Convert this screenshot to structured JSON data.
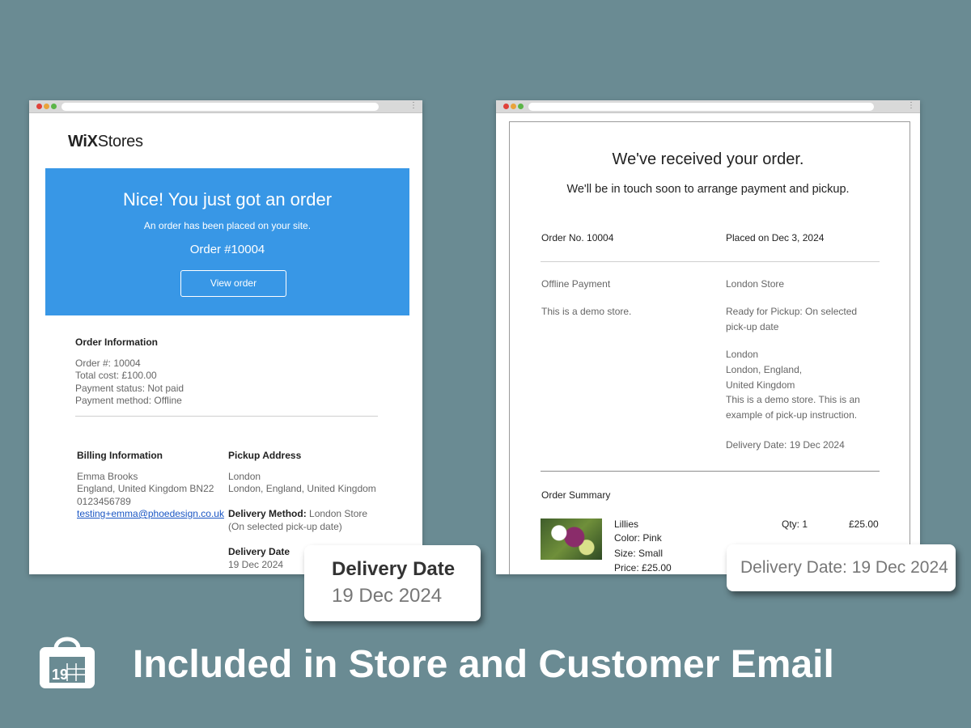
{
  "store_email": {
    "logo": {
      "bold": "WiX",
      "light": "Stores"
    },
    "banner": {
      "title": "Nice! You just got an order",
      "subtitle": "An order has been placed on your site.",
      "order_number": "Order #10004",
      "button": "View order"
    },
    "order_info": {
      "heading": "Order Information",
      "lines": [
        "Order #: 10004",
        "Total cost: £100.00",
        "Payment status: Not paid",
        "Payment method: Offline"
      ]
    },
    "billing": {
      "heading": "Billing Information",
      "name": "Emma Brooks",
      "address": "England, United Kingdom BN22",
      "phone": "0123456789",
      "email": "testing+emma@phoedesign.co.uk"
    },
    "pickup": {
      "heading": "Pickup Address",
      "city": "London",
      "address": "London, England, United Kingdom",
      "method_label": "Delivery Method:",
      "method_value": "London Store",
      "method_note": "(On selected pick-up date)",
      "date_heading": "Delivery Date",
      "date_value": "19 Dec 2024"
    }
  },
  "customer_email": {
    "title": "We've received your order.",
    "subtitle": "We'll be in touch soon to arrange payment and pickup.",
    "order_no": "Order No. 10004",
    "placed_on": "Placed on Dec 3, 2024",
    "payment_title": "Offline Payment",
    "payment_note": "This is a demo store.",
    "store_name": "London Store",
    "pickup_status_1": "Ready for Pickup: On selected",
    "pickup_status_2": "pick-up date",
    "addr_1": "London",
    "addr_2": "London, England,",
    "addr_3": "United Kingdom",
    "instr_1": "This is a demo store. This is an",
    "instr_2": "example of pick-up instruction.",
    "delivery_date": "Delivery Date: 19 Dec 2024",
    "summary_heading": "Order Summary",
    "item": {
      "name": "Lillies",
      "color": "Color: Pink",
      "size": "Size: Small",
      "price": "Price: £25.00",
      "qty": "Qty: 1",
      "total": "£25.00"
    }
  },
  "callouts": {
    "left_title": "Delivery Date",
    "left_value": "19 Dec 2024",
    "right_text": "Delivery Date: 19 Dec 2024"
  },
  "footer": {
    "icon_number": "19",
    "title": "Included in Store and Customer Email"
  },
  "colors": {
    "background": "#6a8b93",
    "banner": "#3897e6",
    "link": "#1a56c4"
  }
}
